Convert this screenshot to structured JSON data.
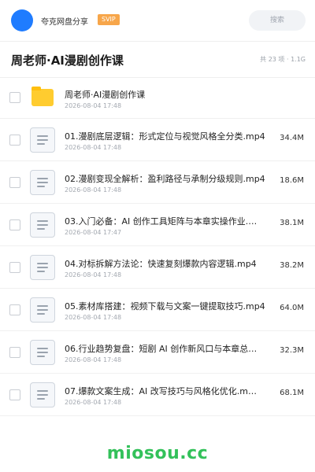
{
  "header": {
    "app_name": "夸克网盘分享",
    "badge": "SVIP",
    "search_placeholder": "搜索"
  },
  "title": "周老师·AI漫剧创作课",
  "meta": "共 23 项 · 1.1G",
  "files": [
    {
      "name": "周老师·AI漫剧创作课",
      "date": "2026-08-04 17:48",
      "size": "",
      "icon": "folder-icon"
    },
    {
      "name": "01.漫剧底层逻辑：形式定位与视觉风格全分类.mp4",
      "date": "2026-08-04 17:48",
      "size": "34.4M",
      "icon": "document-icon"
    },
    {
      "name": "02.漫剧变现全解析：盈利路径与承制分级规则.mp4",
      "date": "2026-08-04 17:48",
      "size": "18.6M",
      "icon": "document-icon"
    },
    {
      "name": "03.入门必备：AI 创作工具矩阵与本章实操作业.…",
      "date": "2026-08-04 17:47",
      "size": "38.1M",
      "icon": "document-icon"
    },
    {
      "name": "04.对标拆解方法论：快速复刻爆款内容逻辑.mp4",
      "date": "2026-08-04 17:48",
      "size": "38.2M",
      "icon": "document-icon"
    },
    {
      "name": "05.素材库搭建：视频下载与文案一键提取技巧.mp4",
      "date": "2026-08-04 17:48",
      "size": "64.0M",
      "icon": "document-icon"
    },
    {
      "name": "06.行业趋势复盘：短剧 AI 创作新风口与本章总…",
      "date": "2026-08-04 17:48",
      "size": "32.3M",
      "icon": "document-icon"
    },
    {
      "name": "07.爆款文案生成：AI 改写技巧与风格化优化.m…",
      "date": "2026-08-04 17:48",
      "size": "68.1M",
      "icon": "document-icon"
    }
  ],
  "watermark": "miosou.cc",
  "colors": {
    "avatar": "#1f7cff",
    "svip": "#f7a64a",
    "folder": "#ffcc2f",
    "watermark": "#33c15a"
  }
}
